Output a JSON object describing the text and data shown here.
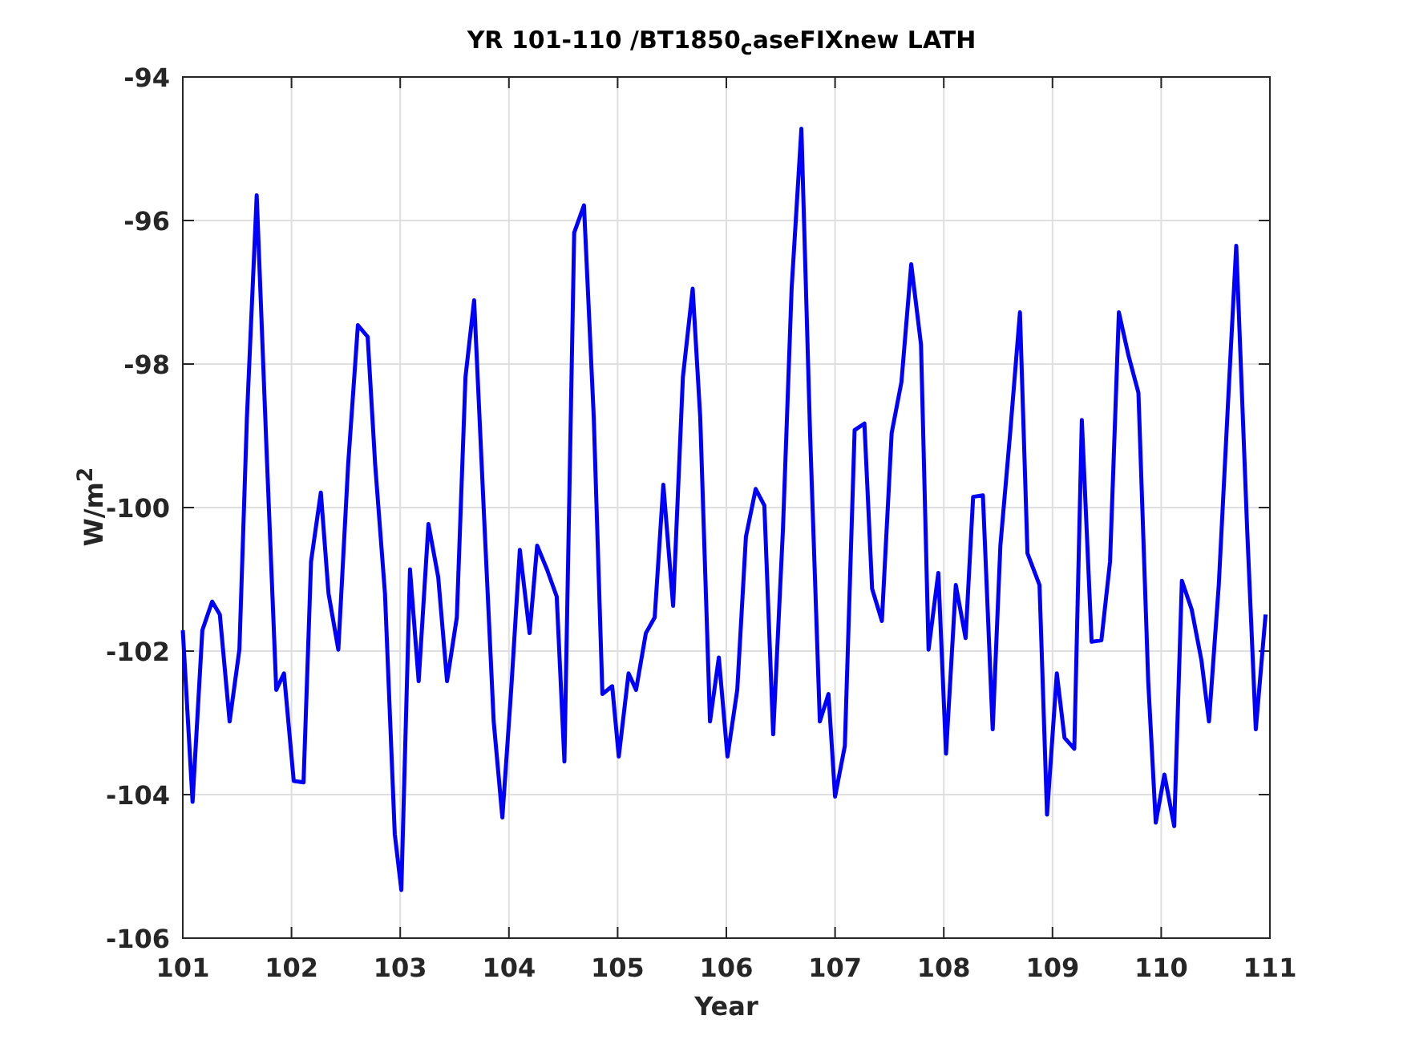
{
  "figure": {
    "chart_data": {
      "type": "line",
      "title": "YR 101-110 /BT1850$_{c}$aseFIXnew LATH",
      "xlabel": "Year",
      "ylabel": "W/m$^{2}$",
      "x": [
        101.0,
        101.09,
        101.18,
        101.27,
        101.34,
        101.43,
        101.52,
        101.59,
        101.68,
        101.77,
        101.86,
        101.93,
        102.02,
        102.11,
        102.18,
        102.27,
        102.34,
        102.43,
        102.52,
        102.61,
        102.7,
        102.77,
        102.86,
        102.95,
        103.01,
        103.09,
        103.17,
        103.26,
        103.35,
        103.43,
        103.52,
        103.6,
        103.68,
        103.77,
        103.86,
        103.94,
        104.02,
        104.1,
        104.19,
        104.26,
        104.35,
        104.44,
        104.51,
        104.6,
        104.69,
        104.78,
        104.86,
        104.95,
        105.01,
        105.1,
        105.17,
        105.26,
        105.34,
        105.42,
        105.51,
        105.6,
        105.69,
        105.76,
        105.85,
        105.93,
        106.01,
        106.1,
        106.18,
        106.27,
        106.35,
        106.43,
        106.52,
        106.6,
        106.69,
        106.77,
        106.86,
        106.94,
        107.0,
        107.09,
        107.18,
        107.27,
        107.34,
        107.43,
        107.52,
        107.61,
        107.7,
        107.79,
        107.86,
        107.95,
        108.02,
        108.11,
        108.2,
        108.27,
        108.36,
        108.45,
        108.52,
        108.61,
        108.7,
        108.77,
        108.88,
        108.95,
        109.04,
        109.11,
        109.2,
        109.27,
        109.36,
        109.45,
        109.53,
        109.61,
        109.7,
        109.79,
        109.88,
        109.95,
        110.03,
        110.12,
        110.19,
        110.28,
        110.37,
        110.44,
        110.53,
        110.62,
        110.69,
        110.79,
        110.87,
        110.96
      ],
      "series": [
        {
          "color": "#0000ff",
          "values": [
            -101.71,
            -104.1,
            -101.71,
            -101.31,
            -101.49,
            -102.98,
            -101.98,
            -98.74,
            -95.65,
            -99.18,
            -102.54,
            -102.31,
            -103.81,
            -103.83,
            -100.75,
            -99.79,
            -101.2,
            -101.98,
            -99.41,
            -97.46,
            -97.62,
            -99.41,
            -101.2,
            -104.55,
            -105.33,
            -100.86,
            -102.42,
            -100.23,
            -100.97,
            -102.42,
            -101.53,
            -98.18,
            -97.11,
            -100.08,
            -102.98,
            -104.32,
            -102.54,
            -100.59,
            -101.75,
            -100.53,
            -100.86,
            -101.24,
            -103.54,
            -96.17,
            -95.79,
            -98.74,
            -102.6,
            -102.49,
            -103.47,
            -102.31,
            -102.54,
            -101.75,
            -101.53,
            -99.68,
            -101.37,
            -98.18,
            -96.95,
            -98.74,
            -102.98,
            -102.09,
            -103.47,
            -102.54,
            -100.41,
            -99.74,
            -99.97,
            -103.16,
            -100.3,
            -96.95,
            -94.72,
            -98.96,
            -102.98,
            -102.6,
            -104.03,
            -103.32,
            -98.92,
            -98.83,
            -101.13,
            -101.58,
            -98.96,
            -98.25,
            -96.61,
            -97.73,
            -101.98,
            -100.91,
            -103.43,
            -101.08,
            -101.82,
            -99.85,
            -99.83,
            -103.09,
            -100.53,
            -98.96,
            -97.28,
            -100.64,
            -101.08,
            -104.28,
            -102.31,
            -103.21,
            -103.36,
            -98.78,
            -101.87,
            -101.85,
            -100.75,
            -97.28,
            -97.89,
            -98.4,
            -102.42,
            -104.39,
            -103.72,
            -104.44,
            -101.02,
            -101.42,
            -102.13,
            -102.98,
            -101.08,
            -98.4,
            -96.35,
            -100.3,
            -103.09,
            -101.49
          ]
        }
      ],
      "grid": true,
      "xlim": [
        101,
        111
      ],
      "ylim": [
        -106,
        -94
      ],
      "xticks": [
        101,
        102,
        103,
        104,
        105,
        106,
        107,
        108,
        109,
        110,
        111
      ],
      "yticks": [
        -106,
        -104,
        -102,
        -100,
        -98,
        -96,
        -94
      ]
    }
  }
}
